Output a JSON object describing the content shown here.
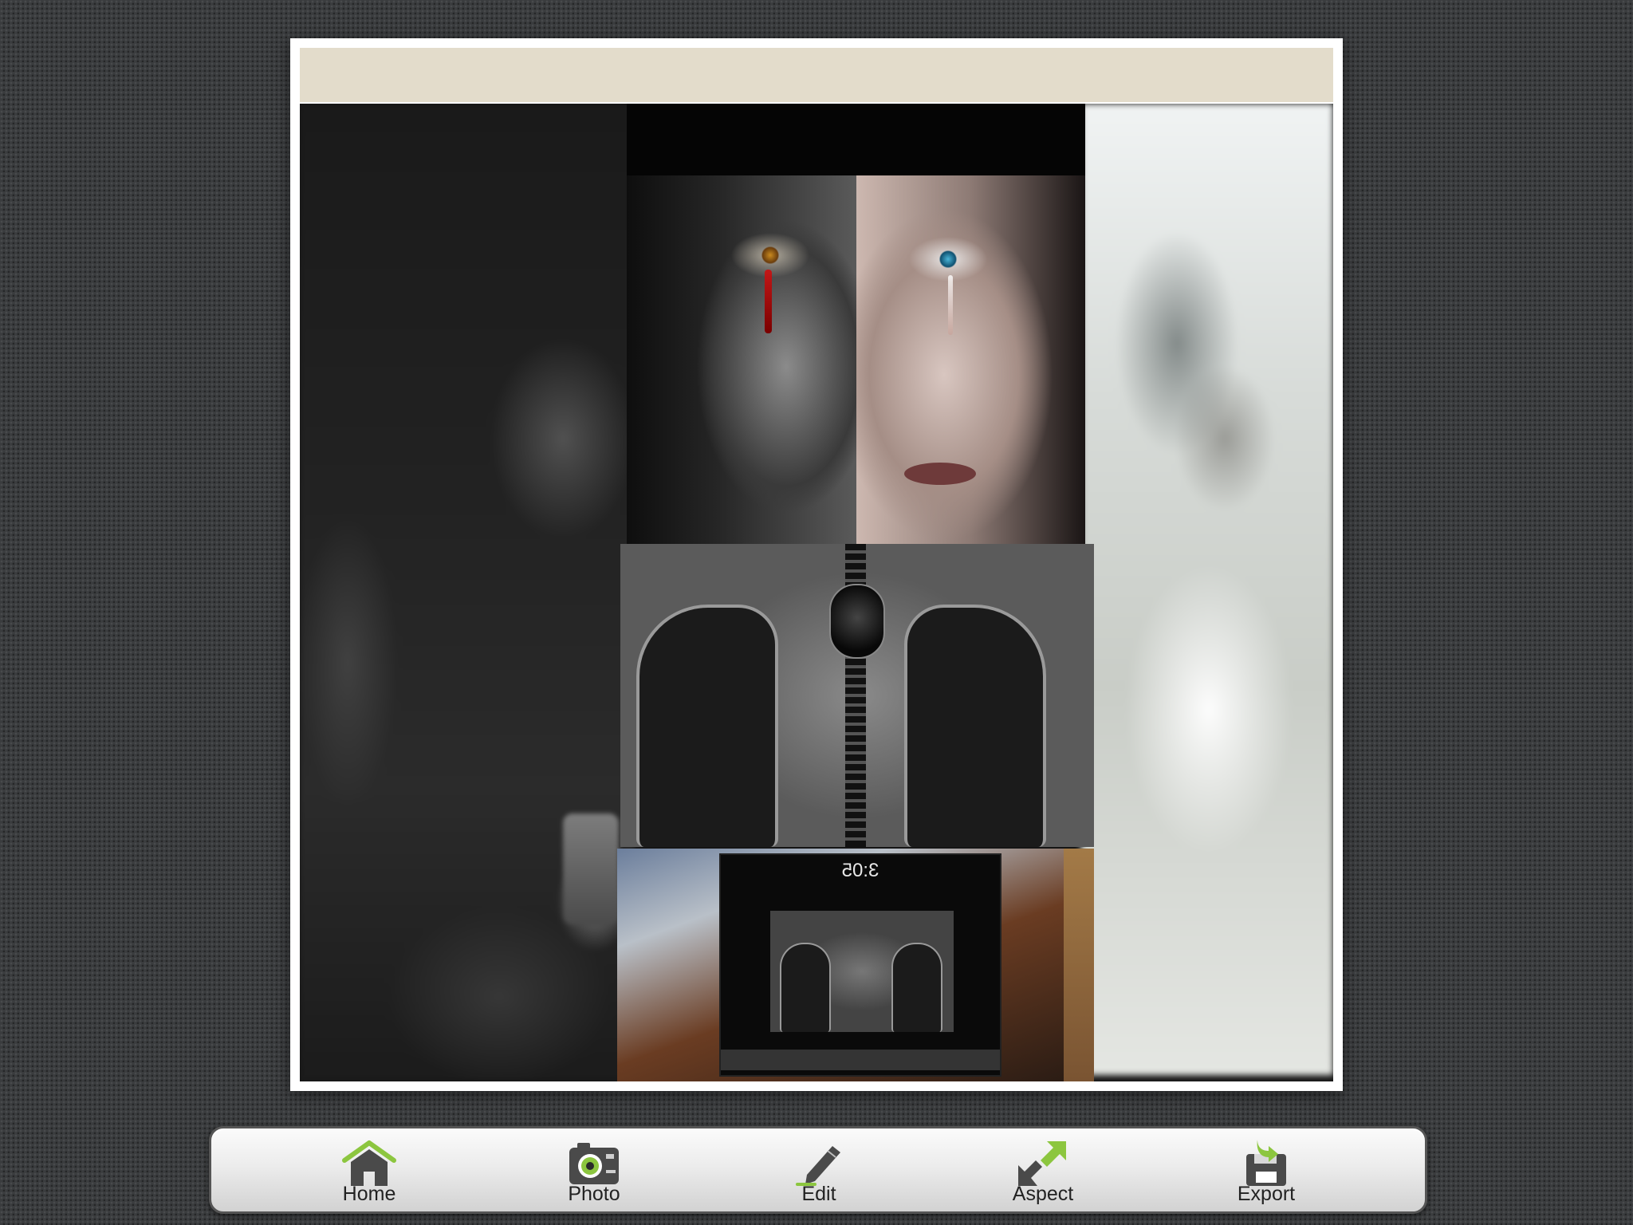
{
  "collage": {
    "ipad_clock": "3:05"
  },
  "toolbar": {
    "accent_color": "#8cc63f",
    "items": [
      {
        "label": "Home",
        "icon": "home-icon"
      },
      {
        "label": "Photo",
        "icon": "camera-icon"
      },
      {
        "label": "Edit",
        "icon": "pencil-icon"
      },
      {
        "label": "Aspect",
        "icon": "aspect-arrows-icon"
      },
      {
        "label": "Export",
        "icon": "save-disk-icon"
      }
    ]
  }
}
